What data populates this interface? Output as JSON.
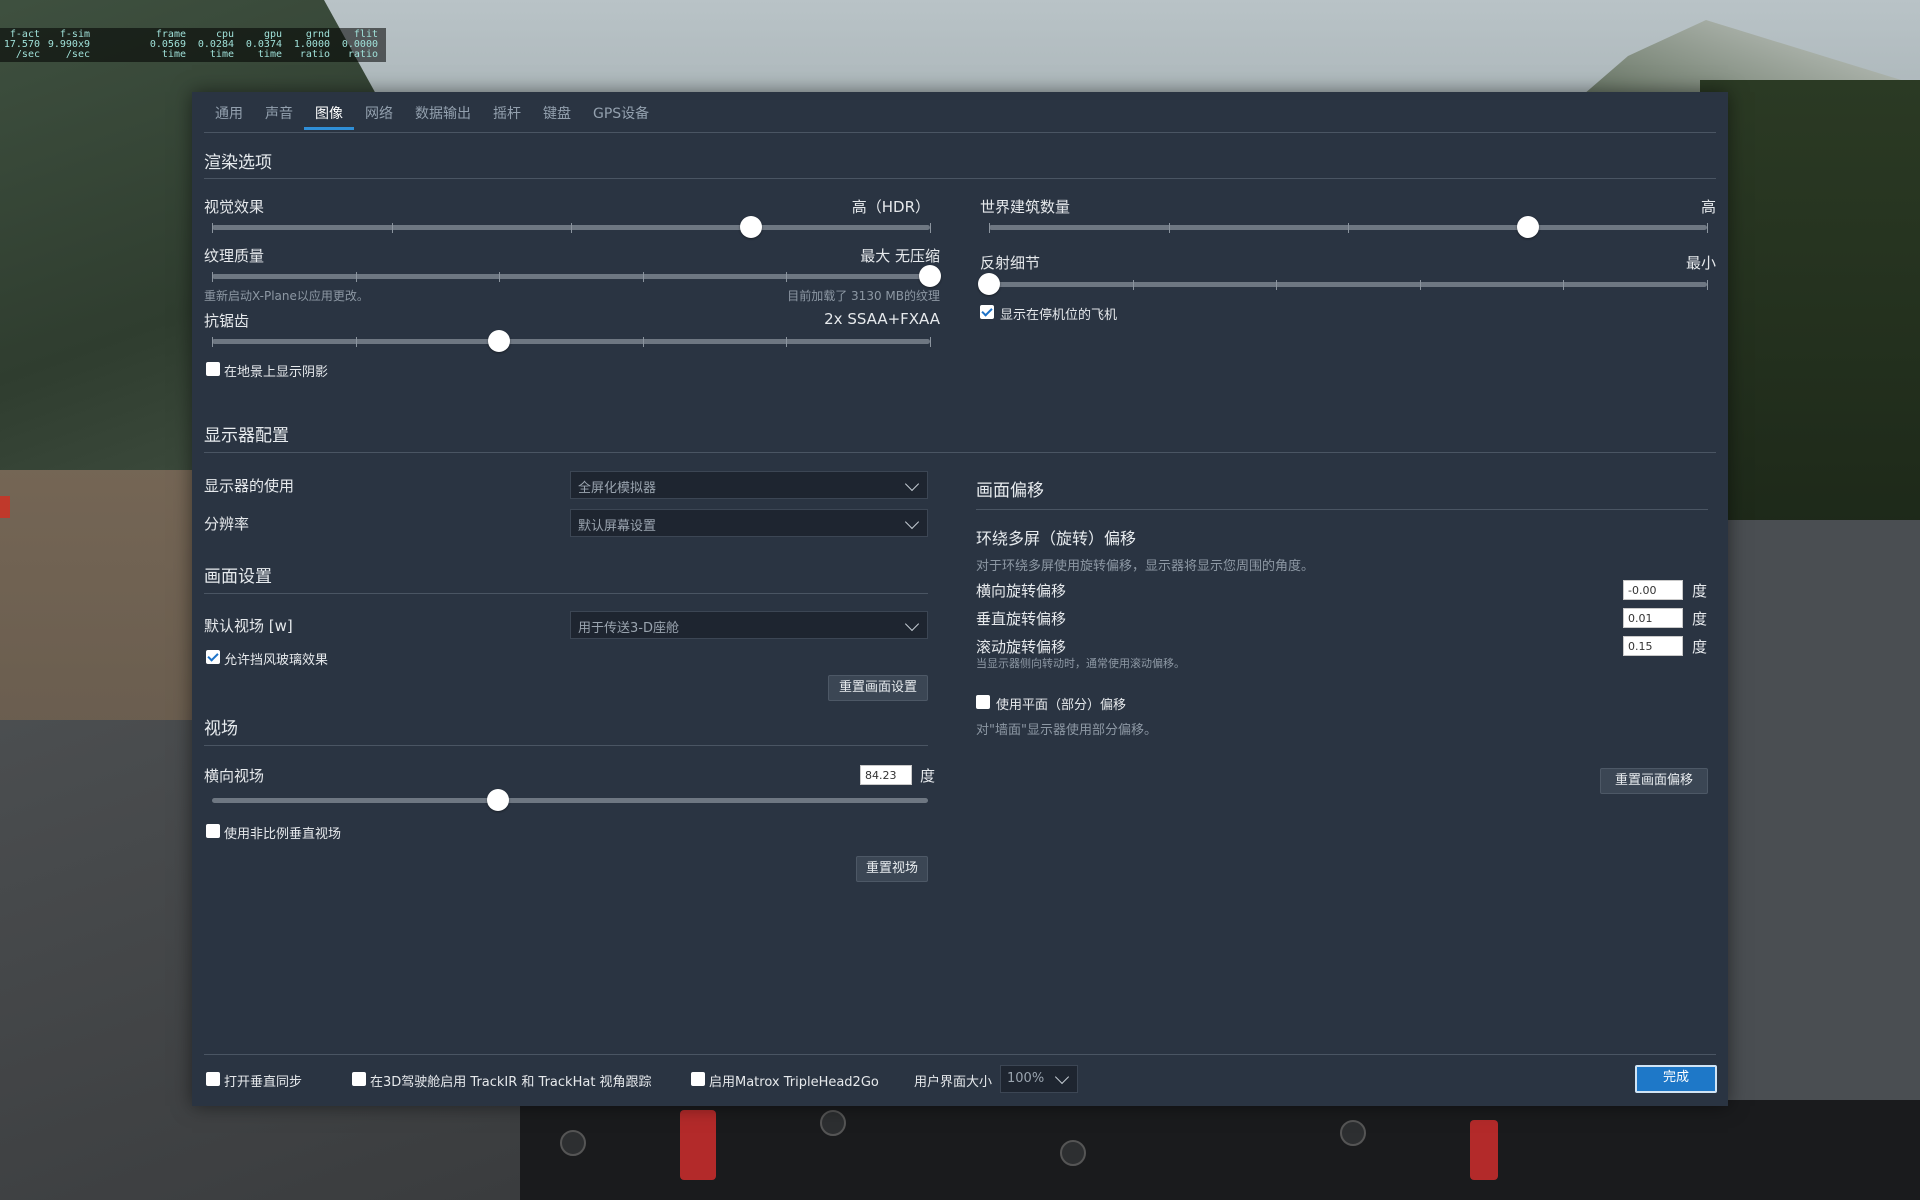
{
  "perf": {
    "columns": [
      {
        "head": "f-act",
        "value": "17.570",
        "unit": "/sec"
      },
      {
        "head": "f-sim",
        "value": "9.990x9",
        "unit": "/sec"
      },
      {
        "head": "frame",
        "value": "0.0569",
        "unit": "time"
      },
      {
        "head": "cpu",
        "value": "0.0284",
        "unit": "time"
      },
      {
        "head": "gpu",
        "value": "0.0374",
        "unit": "time"
      },
      {
        "head": "grnd",
        "value": "1.0000",
        "unit": "ratio"
      },
      {
        "head": "flit",
        "value": "0.0000",
        "unit": "ratio"
      }
    ]
  },
  "tabs": [
    "通用",
    "声音",
    "图像",
    "网络",
    "数据输出",
    "摇杆",
    "键盘",
    "GPS设备"
  ],
  "active_tab": "图像",
  "render": {
    "title": "渲染选项",
    "visual_effects": {
      "label": "视觉效果",
      "value": "高（HDR）",
      "level": 0.75
    },
    "texture_quality": {
      "label": "纹理质量",
      "value": "最大 无压缩",
      "level": 1.0,
      "hint_left": "重新启动X-Plane以应用更改。",
      "hint_right": "目前加载了 3130 MB的纹理"
    },
    "antialiasing": {
      "label": "抗锯齿",
      "value": "2x SSAA+FXAA",
      "level": 0.4
    },
    "shadows_checkbox": {
      "label": "在地景上显示阴影",
      "checked": false
    },
    "world_objects": {
      "label": "世界建筑数量",
      "value": "高",
      "level": 0.75
    },
    "reflection_detail": {
      "label": "反射细节",
      "value": "最小",
      "level": 0.0
    },
    "parked_aircraft_checkbox": {
      "label": "显示在停机位的飞机",
      "checked": true
    }
  },
  "monitor": {
    "title": "显示器配置",
    "usage": {
      "label": "显示器的使用",
      "value": "全屏化模拟器"
    },
    "resolution": {
      "label": "分辨率",
      "value": "默认屏幕设置"
    }
  },
  "view_settings": {
    "title": "画面设置",
    "default_view": {
      "label": "默认视场 [w]",
      "value": "用于传送3-D座舱"
    },
    "windshield_checkbox": {
      "label": "允许挡风玻璃效果",
      "checked": true
    },
    "reset_button": "重置画面设置"
  },
  "fov": {
    "title": "视场",
    "horizontal": {
      "label": "横向视场",
      "value": "84.23",
      "unit": "度",
      "level": 0.4
    },
    "nonproportional_checkbox": {
      "label": "使用非比例垂直视场",
      "checked": false
    },
    "reset_button": "重置视场"
  },
  "offset": {
    "title": "画面偏移",
    "surround_title": "环绕多屏（旋转）偏移",
    "surround_hint": "对于环绕多屏使用旋转偏移，显示器将显示您周围的角度。",
    "lateral": {
      "label": "横向旋转偏移",
      "value": "-0.00",
      "unit": "度"
    },
    "vertical": {
      "label": "垂直旋转偏移",
      "value": "0.01",
      "unit": "度"
    },
    "roll": {
      "label": "滚动旋转偏移",
      "value": "0.15",
      "unit": "度"
    },
    "roll_hint": "当显示器侧向转动时，通常使用滚动偏移。",
    "flat_checkbox": {
      "label": "使用平面（部分）偏移",
      "checked": false
    },
    "flat_hint": "对\"墙面\"显示器使用部分偏移。",
    "reset_button": "重置画面偏移"
  },
  "footer": {
    "vsync": {
      "label": "打开垂直同步",
      "checked": false
    },
    "trackir": {
      "label": "在3D驾驶舱启用 TrackIR 和 TrackHat 视角跟踪",
      "checked": false
    },
    "matrox": {
      "label": "启用Matrox TripleHead2Go",
      "checked": false
    },
    "ui_size_label": "用户界面大小",
    "ui_size_value": "100%",
    "done_button": "完成"
  },
  "colors": {
    "dialog_bg": "#2a3442",
    "accent": "#1e78c8",
    "tab_underline": "#2f8fd8"
  }
}
